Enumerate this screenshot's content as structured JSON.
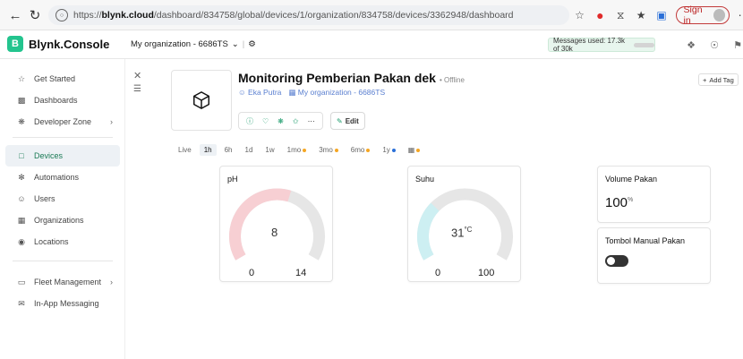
{
  "browser": {
    "url_prefix": "https://",
    "url_host": "blynk.cloud",
    "url_path": "/dashboard/834758/global/devices/1/organization/834758/devices/3362948/dashboard",
    "signin_label": "Sign in"
  },
  "app": {
    "logo_letter": "B",
    "logo_text": "Blynk.Console",
    "org_name": "My organization - 6686TS",
    "messages_used": "Messages used: 17.3k of 30k",
    "messages_fraction": 0.58
  },
  "sidebar": {
    "items": [
      {
        "label": "Get Started",
        "icon": "star-icon"
      },
      {
        "label": "Dashboards",
        "icon": "chart-icon"
      },
      {
        "label": "Developer Zone",
        "icon": "gear-icon"
      },
      {
        "label": "Devices",
        "icon": "device-icon"
      },
      {
        "label": "Automations",
        "icon": "automation-icon"
      },
      {
        "label": "Users",
        "icon": "users-icon"
      },
      {
        "label": "Organizations",
        "icon": "organization-icon"
      },
      {
        "label": "Locations",
        "icon": "location-icon"
      },
      {
        "label": "Fleet Management",
        "icon": "fleet-icon"
      },
      {
        "label": "In-App Messaging",
        "icon": "message-icon"
      }
    ]
  },
  "device": {
    "name": "Monitoring Pemberian Pakan dek",
    "status": "Offline",
    "owner": "Eka Putra",
    "organization": "My organization - 6686TS",
    "edit_label": "Edit",
    "add_tag_label": "Add Tag"
  },
  "time_ranges": [
    "Live",
    "1h",
    "6h",
    "1d",
    "1w",
    "1mo",
    "3mo",
    "6mo",
    "1y"
  ],
  "active_range": "1h",
  "colors": {
    "brand": "#23c48e",
    "gauge_ph": "#f7cfd3",
    "gauge_suhu": "#cdeff2",
    "gauge_track": "#e6e6e6"
  },
  "widgets": {
    "ph": {
      "title": "pH",
      "value": "8",
      "unit": "",
      "min": "0",
      "max": "14"
    },
    "suhu": {
      "title": "Suhu",
      "value": "31",
      "unit": "°C",
      "min": "0",
      "max": "100"
    },
    "volume": {
      "title": "Volume Pakan",
      "value": "100",
      "unit": "%"
    },
    "tombol": {
      "title": "Tombol Manual Pakan",
      "state": "off"
    }
  }
}
